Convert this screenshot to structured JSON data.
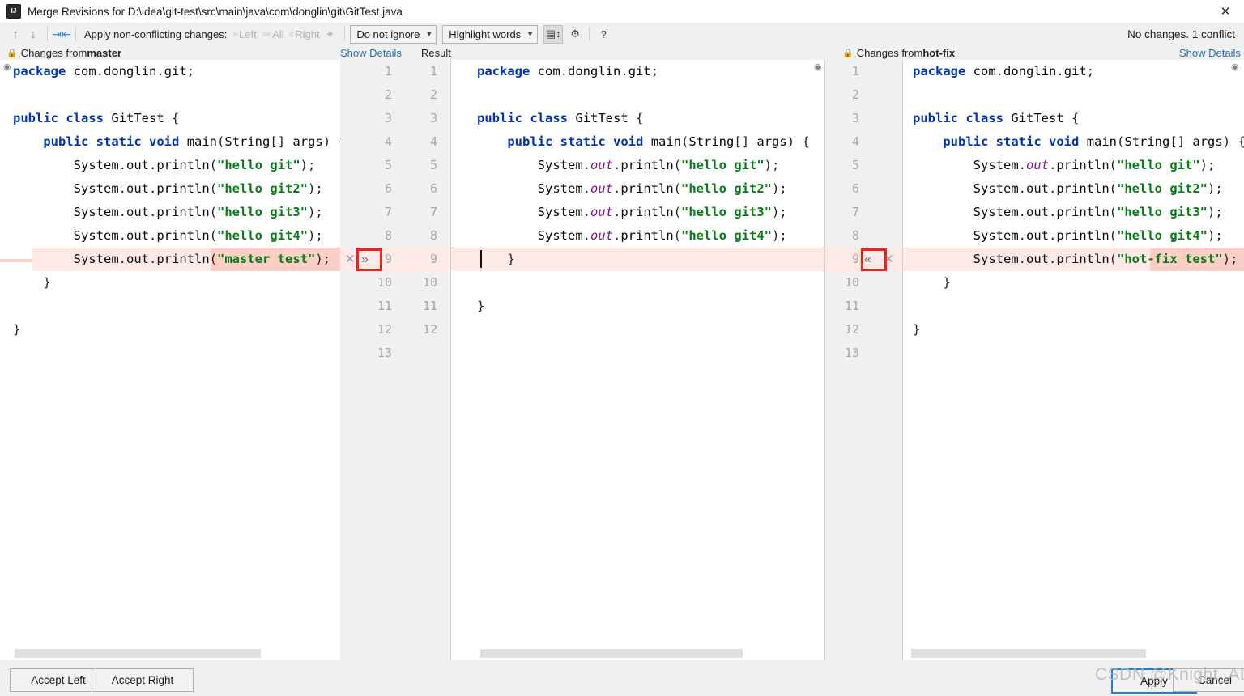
{
  "window": {
    "title": "Merge Revisions for D:\\idea\\git-test\\src\\main\\java\\com\\donglin\\git\\GitTest.java",
    "app_icon": "intellij-idea-icon",
    "close_label": "✕"
  },
  "toolbar": {
    "prev_diff_icon": "arrow-up-icon",
    "next_diff_icon": "arrow-down-icon",
    "apply_all_icon": "apply-non-conflicting-icon",
    "apply_label": "Apply non-conflicting changes:",
    "left_label": "Left",
    "all_label": "All",
    "right_label": "Right",
    "magic_icon": "magic-wand-icon",
    "ignore_policy": "Do not ignore",
    "highlight_policy": "Highlight words",
    "collapse_icon": "collapse-unchanged-icon",
    "settings_icon": "gear-icon",
    "help_icon": "question-mark-icon",
    "status": "No changes. 1 conflict"
  },
  "headers": {
    "left": {
      "lock_icon": "lock-icon",
      "prefix": "Changes from ",
      "branch": "master"
    },
    "left_show_details": "Show Details",
    "result_label": "Result",
    "right": {
      "lock_icon": "lock-icon",
      "prefix": "Changes from ",
      "branch": "hot-fix"
    },
    "right_show_details": "Show Details"
  },
  "left_pane": {
    "name": "master",
    "inspection_icon": "inspection-eye-icon",
    "lines": [
      {
        "n": 1,
        "text": "package com.donglin.git;"
      },
      {
        "n": 2,
        "text": ""
      },
      {
        "n": 3,
        "text": "public class GitTest {"
      },
      {
        "n": 4,
        "text": "    public static void main(String[] args) {"
      },
      {
        "n": 5,
        "text": "        System.out.println(\"hello git\");"
      },
      {
        "n": 6,
        "text": "        System.out.println(\"hello git2\");"
      },
      {
        "n": 7,
        "text": "        System.out.println(\"hello git3\");"
      },
      {
        "n": 8,
        "text": "        System.out.println(\"hello git4\");"
      },
      {
        "n": 9,
        "text": "        System.out.println(\"master test\");",
        "conflict": true
      },
      {
        "n": 10,
        "text": "    }"
      },
      {
        "n": 11,
        "text": ""
      },
      {
        "n": 12,
        "text": "}"
      }
    ]
  },
  "center_pane": {
    "name": "Result",
    "inspection_icon": "inspection-eye-icon",
    "line_numbers_a": [
      1,
      2,
      3,
      4,
      5,
      6,
      7,
      8,
      9,
      10,
      11,
      12,
      13
    ],
    "line_numbers_b": [
      1,
      2,
      3,
      4,
      5,
      6,
      7,
      8,
      9,
      10,
      11,
      12
    ],
    "accept_left_arrow_icon": "double-chevron-right-icon",
    "revert_icon": "close-x-icon",
    "lines": [
      {
        "n": 1,
        "text": "package com.donglin.git;"
      },
      {
        "n": 2,
        "text": ""
      },
      {
        "n": 3,
        "text": "public class GitTest {"
      },
      {
        "n": 4,
        "text": "    public static void main(String[] args) {"
      },
      {
        "n": 5,
        "text": "        System.out.println(\"hello git\");"
      },
      {
        "n": 6,
        "text": "        System.out.println(\"hello git2\");"
      },
      {
        "n": 7,
        "text": "        System.out.println(\"hello git3\");"
      },
      {
        "n": 8,
        "text": "        System.out.println(\"hello git4\");"
      },
      {
        "n": 9,
        "text": "    }",
        "conflict": true
      },
      {
        "n": 10,
        "text": ""
      },
      {
        "n": 11,
        "text": "}"
      }
    ]
  },
  "right_pane": {
    "name": "hot-fix",
    "inspection_icon": "inspection-eye-icon",
    "accept_right_arrow_icon": "double-chevron-left-icon",
    "revert_icon": "close-x-icon",
    "line_numbers": [
      1,
      2,
      3,
      4,
      5,
      6,
      7,
      8,
      9,
      10,
      11,
      12,
      13
    ],
    "lines": [
      {
        "n": 1,
        "text": "package com.donglin.git;"
      },
      {
        "n": 2,
        "text": ""
      },
      {
        "n": 3,
        "text": "public class GitTest {"
      },
      {
        "n": 4,
        "text": "    public static void main(String[] args) {"
      },
      {
        "n": 5,
        "text": "        System.out.println(\"hello git\");"
      },
      {
        "n": 6,
        "text": "        System.out.println(\"hello git2\");"
      },
      {
        "n": 7,
        "text": "        System.out.println(\"hello git3\");"
      },
      {
        "n": 8,
        "text": "        System.out.println(\"hello git4\");"
      },
      {
        "n": 9,
        "text": "        System.out.println(\"hot-fix test\");",
        "conflict": true
      },
      {
        "n": 10,
        "text": "    }"
      },
      {
        "n": 11,
        "text": ""
      },
      {
        "n": 12,
        "text": "}"
      }
    ]
  },
  "annotations": {
    "left_highlight_box": "red-rectangle-callout",
    "right_highlight_box": "red-rectangle-callout",
    "color": "#e8241b"
  },
  "footer": {
    "accept_left": "Accept Left",
    "accept_right": "Accept Right",
    "apply": "Apply",
    "cancel": "Cancel"
  },
  "watermark": {
    "text": "CSDN @Knight_AL"
  },
  "colors": {
    "keyword": "#0033b3",
    "string": "#067d17",
    "field": "#871094",
    "conflict_bg": "#fdeae7",
    "conflict_word_bg": "#fbcfc6",
    "link": "#2470b3",
    "accent": "#1b7fd3"
  }
}
